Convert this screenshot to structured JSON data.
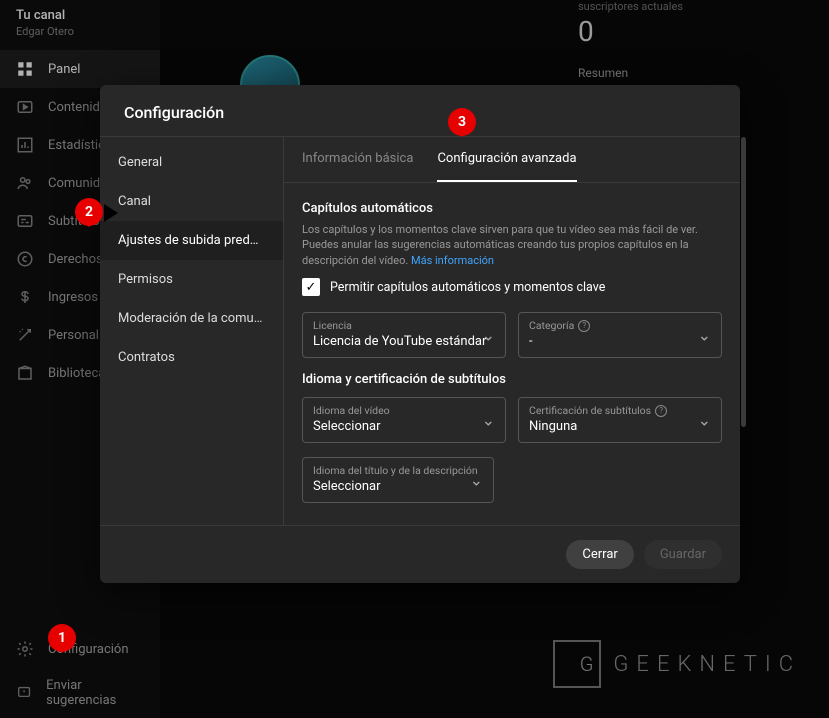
{
  "channel": {
    "title": "Tu canal",
    "name": "Edgar Otero"
  },
  "sidebar": {
    "items": [
      {
        "label": "Panel"
      },
      {
        "label": "Contenido"
      },
      {
        "label": "Estadísticas"
      },
      {
        "label": "Comunidad"
      },
      {
        "label": "Subtítulos"
      },
      {
        "label": "Derechos"
      },
      {
        "label": "Ingresos"
      },
      {
        "label": "Personalizac"
      },
      {
        "label": "Biblioteca de"
      }
    ],
    "bottom": [
      {
        "label": "Configuración"
      },
      {
        "label": "Enviar sugerencias"
      }
    ]
  },
  "bg": {
    "subs_label": "suscriptores actuales",
    "subs_count": "0",
    "summary": "Resumen"
  },
  "modal": {
    "title": "Configuración",
    "sidenav": [
      "General",
      "Canal",
      "Ajustes de subida predeterm...",
      "Permisos",
      "Moderación de la comunidad",
      "Contratos"
    ],
    "tabs": {
      "basic": "Información básica",
      "advanced": "Configuración avanzada"
    },
    "chapters": {
      "title": "Capítulos automáticos",
      "desc": "Los capítulos y los momentos clave sirven para que tu vídeo sea más fácil de ver. Puedes anular las sugerencias automáticas creando tus propios capítulos en la descripción del vídeo. ",
      "link": "Más información",
      "checkbox_label": "Permitir capítulos automáticos y momentos clave"
    },
    "license": {
      "label": "Licencia",
      "value": "Licencia de YouTube estándar"
    },
    "category": {
      "label": "Categoría",
      "value": "-"
    },
    "lang_section": "Idioma y certificación de subtítulos",
    "video_lang": {
      "label": "Idioma del vídeo",
      "value": "Seleccionar"
    },
    "sub_cert": {
      "label": "Certificación de subtítulos",
      "value": "Ninguna"
    },
    "title_lang": {
      "label": "Idioma del título y de la descripción",
      "value": "Seleccionar"
    },
    "footer": {
      "close": "Cerrar",
      "save": "Guardar"
    }
  },
  "bubbles": {
    "b1": "1",
    "b2": "2",
    "b3": "3"
  },
  "watermark": "GEEKNETIC",
  "watermark_logo": "G"
}
